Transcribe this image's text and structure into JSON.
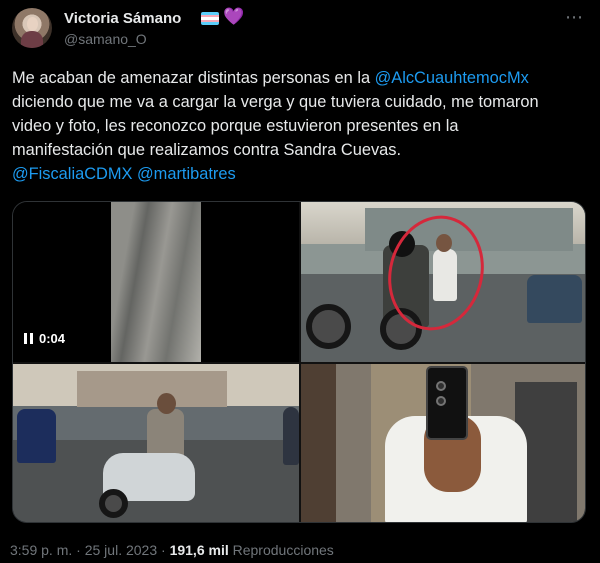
{
  "tweet": {
    "author": {
      "display_name": "Victoria Sámano",
      "handle": "@samano_O",
      "name_icons": [
        "transgender-flag-icon",
        "purple-heart-icon"
      ],
      "heart_glyph": "💜",
      "more_glyph": "⋯"
    },
    "text": {
      "line1_before": "Me acaban de amenazar distintas personas en la ",
      "mention1": "@AlcCuauhtemocMx",
      "line2": "diciendo que me va a cargar la verga y que tuviera cuidado, me tomaron",
      "line3": "video y foto, les reconozco porque estuvieron presentes en la",
      "line4": "manifestación que realizamos contra Sandra Cuevas.",
      "mention2": "@FiscaliaCDMX",
      "mention3": "@martibatres"
    },
    "media": {
      "video_duration": "0:04"
    },
    "meta": {
      "time": "3:59 p. m.",
      "separator1": " · ",
      "date": "25 jul. 2023",
      "separator2": " · ",
      "views": "191,6 mil",
      "views_label": " Reproducciones"
    }
  },
  "colors": {
    "background": "#000000",
    "text": "#e7e9ea",
    "secondary_text": "#71767b",
    "link": "#1d9bf0",
    "border": "#2f3336",
    "highlight_circle": "#d5283b"
  }
}
